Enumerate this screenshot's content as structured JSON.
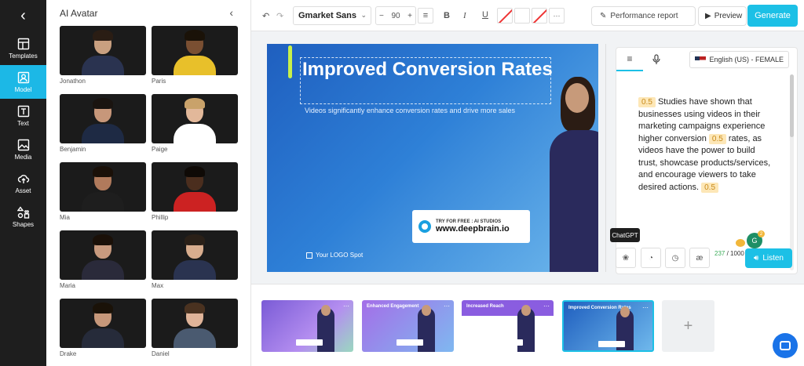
{
  "nav": {
    "items": [
      {
        "label": "Templates",
        "icon": "layout-icon"
      },
      {
        "label": "Model",
        "icon": "person-icon",
        "active": true
      },
      {
        "label": "Text",
        "icon": "text-icon"
      },
      {
        "label": "Media",
        "icon": "image-icon"
      },
      {
        "label": "Asset",
        "icon": "upload-cloud-icon"
      },
      {
        "label": "Shapes",
        "icon": "shapes-icon"
      }
    ]
  },
  "avatar_panel": {
    "title": "AI Avatar",
    "avatars": [
      "Jonathon",
      "Paris",
      "Benjamin",
      "Paige",
      "Mia",
      "Phillip",
      "Maria",
      "Max",
      "Drake",
      "Daniel"
    ]
  },
  "toolbar": {
    "font": "Gmarket Sans",
    "font_size": "90",
    "performance_report": "Performance report",
    "preview": "Preview",
    "generate": "Generate"
  },
  "slide": {
    "headline": "Improved Conversion Rates",
    "subtitle": "Videos significantly enhance conversion rates and drive more sales",
    "badge_small": "TRY FOR FREE : AI STUDIOS",
    "badge_url": "www.deepbrain.io",
    "logo_text": "Your LOGO Spot"
  },
  "script": {
    "language": "English (US) - FEMALE",
    "pause": "0.5",
    "part1": "Studies have shown that businesses using videos in their marketing campaigns experience higher conversion",
    "part2": "rates, as videos have the power to build trust, showcase products/services, and encourage viewers to take desired actions.",
    "gpt_count": "2"
  },
  "bottom": {
    "tooltip": "ChatGPT",
    "count_used": "237",
    "count_max": "/ 1000",
    "listen": "Listen"
  },
  "thumbnails": [
    {
      "title": "",
      "gradient": "linear-gradient(135deg,#7a5bd6,#b48ef0 60%,#9ad8c0)"
    },
    {
      "title": "Enhanced Engagement",
      "gradient": "linear-gradient(135deg,#a46ee8,#7fb8f0)"
    },
    {
      "title": "Increased Reach",
      "gradient": "linear-gradient(180deg,#8a5de0 0 30%,#ffffff 30%)"
    },
    {
      "title": "Improved Conversion Rates",
      "gradient": "linear-gradient(135deg,#1f5fbf,#6fb8ec)"
    }
  ],
  "colors": {
    "accent": "#1cc0e6",
    "nav_bg": "#1e1e1e"
  }
}
